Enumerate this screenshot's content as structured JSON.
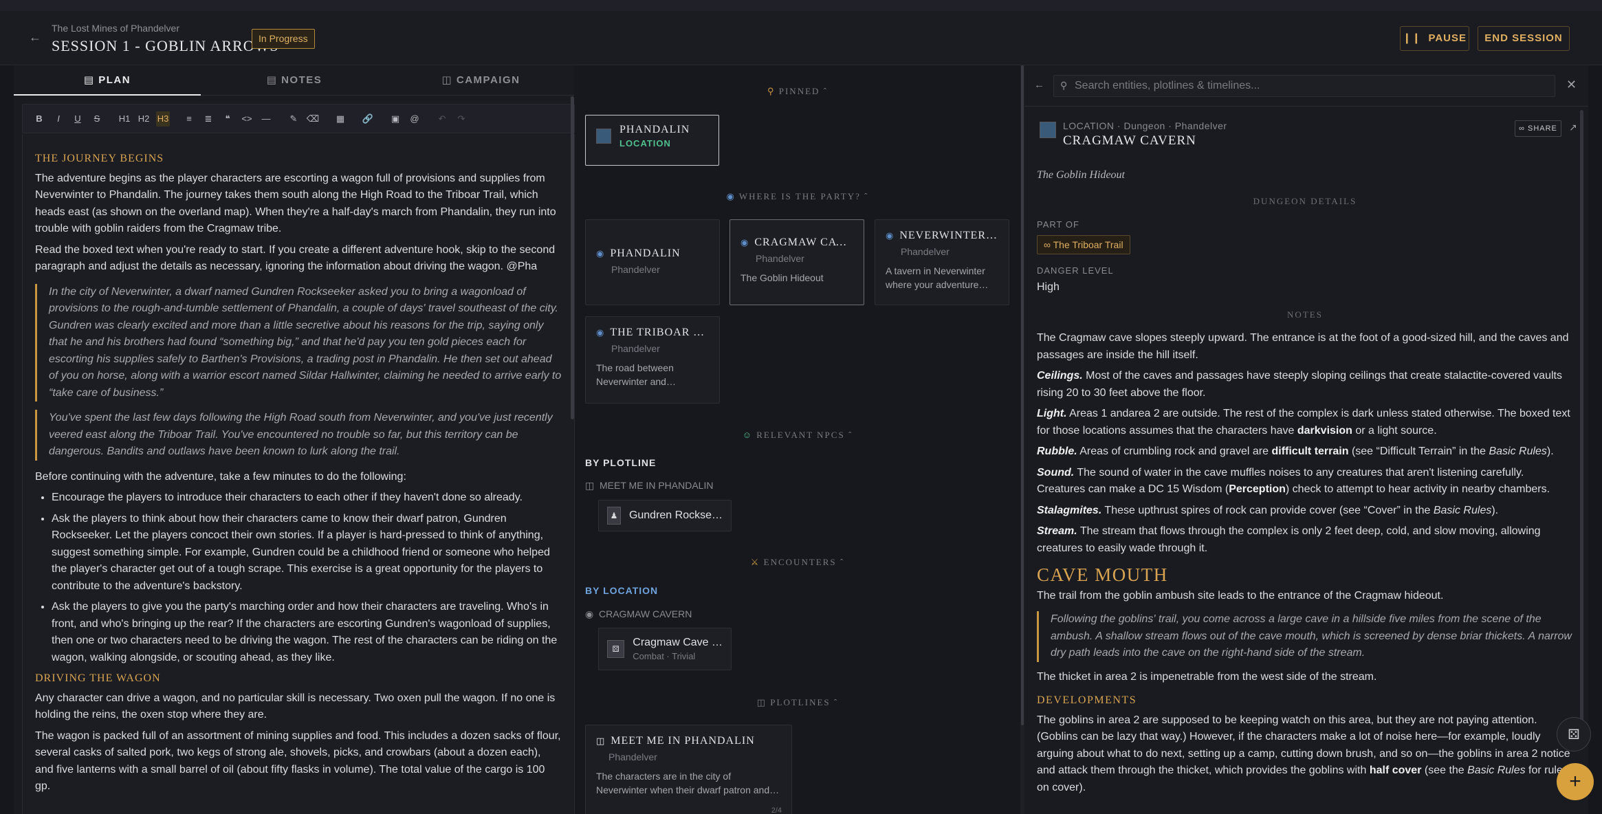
{
  "header": {
    "campaign": "The Lost Mines of Phandelver",
    "session_title": "SESSION 1 - GOBLIN ARROWS",
    "status": "In Progress",
    "pause_label": "PAUSE",
    "end_label": "END SESSION"
  },
  "tabs": [
    {
      "label": "PLAN"
    },
    {
      "label": "NOTES"
    },
    {
      "label": "CAMPAIGN"
    }
  ],
  "editor": {
    "h_journey": "THE JOURNEY BEGINS",
    "p1": "The adventure begins as the player characters are escorting a wagon full of provisions and supplies from Neverwinter to Phandalin. The journey takes them south along the High Road to the Triboar Trail, which heads east (as shown on the overland map). When they're a half-day's march from Phandalin, they run into trouble with goblin raiders from the Cragmaw tribe.",
    "p2": "Read the boxed text when you're ready to start. If you create a different adventure hook, skip to the second paragraph and adjust the details as necessary, ignoring the information about driving the wagon. @Pha",
    "q1": "In the city of Neverwinter, a dwarf named Gundren Rockseeker asked you to bring a wagonload of provisions to the rough-and-tumble settlement of Phandalin, a couple of days' travel southeast of the city. Gundren was clearly excited and more than a little secretive about his reasons for the trip, saying only that he and his brothers had found “something big,” and that he'd pay you ten gold pieces each for escorting his supplies safely to Barthen's Provisions, a trading post in Phandalin. He then set out ahead of you on horse, along with a warrior escort named Sildar Hallwinter, claiming he needed to arrive early to “take care of business.”",
    "q2": "You've spent the last few days following the High Road south from Neverwinter, and you've just recently veered east along the Triboar Trail. You've encountered no trouble so far, but this territory can be dangerous. Bandits and outlaws have been known to lurk along the trail.",
    "p3": "Before continuing with the adventure, take a few minutes to do the following:",
    "li1": "Encourage the players to introduce their characters to each other if they haven't done so already.",
    "li2": "Ask the players to think about how their characters came to know their dwarf patron, Gundren Rockseeker. Let the players concoct their own stories. If a player is hard-pressed to think of anything, suggest something simple. For example, Gundren could be a childhood friend or someone who helped the player's character get out of a tough scrape. This exercise is a great opportunity for the players to contribute to the adventure's backstory.",
    "li3": "Ask the players to give you the party's marching order and how their characters are traveling. Who's in front, and who's bringing up the rear? If the characters are escorting Gundren's wagonload of supplies, then one or two characters need to be driving the wagon. The rest of the characters can be riding on the wagon, walking alongside, or scouting ahead, as they like.",
    "h_driving": "DRIVING THE WAGON",
    "p4": "Any character can drive a wagon, and no particular skill is necessary. Two oxen pull the wagon. If no one is holding the reins, the oxen stop where they are.",
    "p5": "The wagon is packed full of an assortment of mining supplies and food. This includes a dozen sacks of flour, several casks of salted pork, two kegs of strong ale, shovels, picks, and crowbars (about a dozen each), and five lanterns with a small barrel of oil (about fifty flasks in volume). The total value of the cargo is 100 gp."
  },
  "middle": {
    "pinned_label": "PINNED",
    "pinned_card": {
      "title": "PHANDALIN",
      "type": "LOCATION"
    },
    "party_label": "WHERE IS THE PARTY?",
    "locations": [
      {
        "title": "PHANDALIN",
        "sub": "Phandelver",
        "desc": ""
      },
      {
        "title": "CRAGMAW CAVE…",
        "sub": "Phandelver",
        "desc": "The Goblin Hideout"
      },
      {
        "title": "NEVERWINTER T…",
        "sub": "Phandelver",
        "desc": "A tavern in Neverwinter where your adventure…"
      },
      {
        "title": "THE TRIBOAR TR…",
        "sub": "Phandelver",
        "desc": "The road between Neverwinter and…"
      }
    ],
    "npcs_label": "RELEVANT NPCS",
    "by_plotline": "BY PLOTLINE",
    "plotline_name": "MEET ME IN PHANDALIN",
    "npc_chip": "Gundren Rockse…",
    "encounters_label": "ENCOUNTERS",
    "by_location": "BY LOCATION",
    "location_name": "CRAGMAW CAVERN",
    "encounter_title": "Cragmaw Cave …",
    "encounter_sub": "Combat · Trivial",
    "plotlines_label": "PLOTLINES",
    "plot_card": {
      "title": "MEET ME IN PHANDALIN",
      "sub": "Phandelver",
      "desc": "The characters are in the city of Neverwinter when their dwarf patron and…",
      "count": "2/4"
    }
  },
  "right": {
    "search_placeholder": "Search entities, plotlines & timelines...",
    "meta": "LOCATION · Dungeon · Phandelver",
    "title": "CRAGMAW CAVERN",
    "share_label": "SHARE",
    "subtitle": "The Goblin Hideout",
    "dungeon_details": "DUNGEON DETAILS",
    "part_of_label": "PART OF",
    "part_of_value": "The Triboar Trail",
    "danger_label": "DANGER LEVEL",
    "danger_value": "High",
    "notes_label": "NOTES",
    "n1": "The Cragmaw cave slopes steeply upward. The entrance is at the foot of a good-sized hill, and the caves and passages are inside the hill itself.",
    "ceil_t": "Ceilings.",
    "ceil": " Most of the caves and passages have steeply sloping ceilings that create stalactite-covered vaults rising 20 to 30 feet above the floor.",
    "light_t": "Light.",
    "light_a": " Areas 1 andarea 2 are outside. The rest of the complex is dark unless stated otherwise. The boxed text for those locations assumes that the characters have ",
    "light_b": "darkvision",
    "light_c": " or a light source.",
    "rubble_t": "Rubble.",
    "rubble_a": " Areas of crumbling rock and gravel are ",
    "rubble_b": "difficult terrain",
    "rubble_c": " (see “Difficult Terrain” in the ",
    "rubble_d": "Basic Rules",
    "rubble_e": ").",
    "sound_t": "Sound.",
    "sound_a": " The sound of water in the cave muffles noises to any creatures that aren't listening carefully. Creatures can make a DC 15 Wisdom (",
    "sound_b": "Perception",
    "sound_c": ") check to attempt to hear activity in nearby chambers.",
    "stal_t": "Stalagmites.",
    "stal_a": " These upthrust spires of rock can provide cover (see “Cover” in the ",
    "stal_b": "Basic Rules",
    "stal_c": ").",
    "stream_t": "Stream.",
    "stream": " The stream that flows through the complex is only 2 feet deep, cold, and slow moving, allowing creatures to easily wade through it.",
    "cave_mouth": "CAVE MOUTH",
    "cm1": "The trail from the goblin ambush site leads to the entrance of the Cragmaw hideout.",
    "cmq": "Following the goblins' trail, you come across a large cave in a hillside five miles from the scene of the ambush. A shallow stream flows out of the cave mouth, which is screened by dense briar thickets. A narrow dry path leads into the cave on the right-hand side of the stream.",
    "cm2": "The thicket in area 2 is impenetrable from the west side of the stream.",
    "developments": "DEVELOPMENTS",
    "dev_a": "The goblins in area 2 are supposed to be keeping watch on this area, but they are not paying attention. (Goblins can be lazy that way.) However, if the characters make a lot of noise here—for example, loudly arguing about what to do next, setting up a camp, cutting down brush, and so on—the goblins in area 2 notice and attack them through the thicket, which provides the goblins with ",
    "dev_b": "half cover",
    "dev_c": " (see the ",
    "dev_d": "Basic Rules",
    "dev_e": " for rules on cover)."
  }
}
